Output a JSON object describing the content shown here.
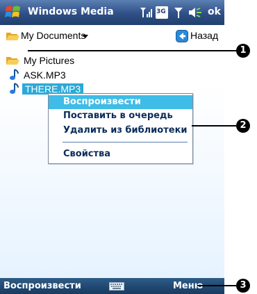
{
  "titlebar": {
    "title": "Windows Media",
    "ok_label": "ok",
    "icons": [
      "start-logo-icon",
      "signal-strength-icon",
      "3g-icon",
      "antenna-icon",
      "speaker-icon"
    ],
    "network_label": "3G"
  },
  "navbar": {
    "folder_label": "My Documents",
    "back_label": "Назад"
  },
  "files": [
    {
      "name": "My Pictures",
      "type": "folder"
    },
    {
      "name": "ASK.MP3",
      "type": "audio"
    },
    {
      "name": "THERE.MP3",
      "type": "audio",
      "selected": true
    }
  ],
  "context_menu": {
    "items": [
      {
        "label": "Воспроизвести",
        "highlighted": true
      },
      {
        "label": "Поставить в очередь"
      },
      {
        "label": "Удалить из библиотеки"
      },
      {
        "label": "Свойства"
      }
    ]
  },
  "bottombar": {
    "left_softkey": "Воспроизвести",
    "right_softkey": "Меню",
    "center_icon": "keyboard-icon"
  },
  "callouts": [
    "1",
    "2",
    "3"
  ],
  "colors": {
    "titlebar": "#2f4f86",
    "selection": "#2ca9d8",
    "menu_highlight": "#3fbce7",
    "bottombar": "#1f4770"
  }
}
